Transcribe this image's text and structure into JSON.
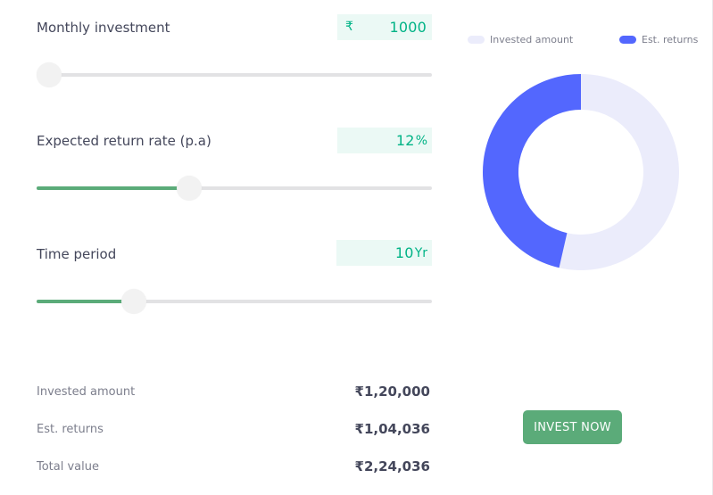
{
  "inputs": [
    {
      "label": "Monthly investment",
      "prefix": "₹",
      "value": "1000",
      "unit": "",
      "slider_fraction": 0.0
    },
    {
      "label": "Expected return rate (p.a)",
      "prefix": "",
      "value": "12",
      "unit": "%",
      "slider_fraction": 0.387
    },
    {
      "label": "Time period",
      "prefix": "",
      "value": "10",
      "unit": "Yr",
      "slider_fraction": 0.246
    }
  ],
  "summary": [
    {
      "label": "Invested amount",
      "value": "₹1,20,000"
    },
    {
      "label": "Est. returns",
      "value": "₹1,04,036"
    },
    {
      "label": "Total value",
      "value": "₹2,24,036"
    }
  ],
  "legend": {
    "invested": {
      "label": "Invested amount",
      "color": "#ebecfb"
    },
    "returns": {
      "label": "Est. returns",
      "color": "#5367fe"
    }
  },
  "chart_data": {
    "type": "pie",
    "categories": [
      "Invested amount",
      "Est. returns"
    ],
    "values": [
      120000,
      104036
    ],
    "colors": [
      "#ebecfb",
      "#5367fe"
    ],
    "donut": true,
    "legend_position": "top"
  },
  "colors": {
    "accent_green": "#5bab79",
    "value_text_green": "#00b386",
    "value_box_bg": "#ebf9f5",
    "track_gray": "#e2e2e4"
  },
  "cta": {
    "label": "INVEST NOW"
  }
}
